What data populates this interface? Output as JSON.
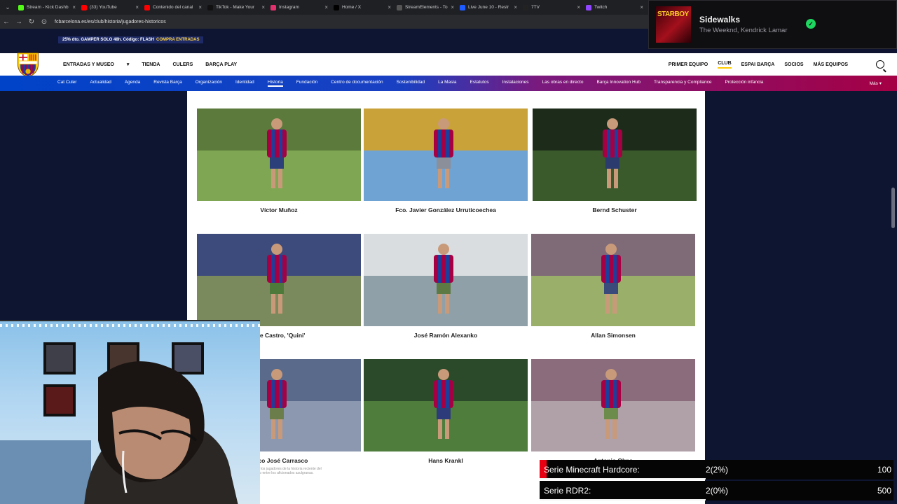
{
  "browser": {
    "tabs": [
      {
        "label": "Stream - Kick Dashb",
        "color": "#53fc18"
      },
      {
        "label": "(33) YouTube",
        "color": "#ff0000"
      },
      {
        "label": "Contenido del canal",
        "color": "#ff0000"
      },
      {
        "label": "TikTok - Make Your",
        "color": "#111111"
      },
      {
        "label": "Instagram",
        "color": "#e1306c"
      },
      {
        "label": "Home / X",
        "color": "#000000"
      },
      {
        "label": "StreamElements - To",
        "color": "#555555"
      },
      {
        "label": "Live June 10 - Restr",
        "color": "#1e5bff"
      },
      {
        "label": "7TV",
        "color": "#222222"
      },
      {
        "label": "Twitch",
        "color": "#9146ff"
      }
    ],
    "url": "fcbarcelona.es/es/club/historia/jugadores-historicos"
  },
  "now_playing": {
    "album_text": "STARBOY",
    "title": "Sidewalks",
    "artist": "The Weeknd, Kendrick Lamar"
  },
  "promo": {
    "text": "25% dto. GAMPER SOLO 48h. Código: FLASH",
    "cta": "COMPRA ENTRADAS"
  },
  "main_nav": {
    "left": [
      "ENTRADAS Y MUSEO",
      "TIENDA",
      "CULERS",
      "BARÇA PLAY"
    ],
    "right": [
      "PRIMER EQUIPO",
      "CLUB",
      "ESPAI BARÇA",
      "SOCIOS",
      "MÁS EQUIPOS"
    ],
    "active": "CLUB"
  },
  "sub_nav": {
    "items": [
      "Cat Culer",
      "Actualidad",
      "Agenda",
      "Revista Barça",
      "Organización",
      "Identidad",
      "Historia",
      "Fundación",
      "Centro de documentación",
      "Sostenibilidad",
      "La Masia",
      "Estatutos",
      "Instalaciones",
      "Las obras en directo",
      "Barça Innovation Hub",
      "Transparencia y Compliance",
      "Protección infancia"
    ],
    "active": "Historia",
    "more": "Más"
  },
  "players": [
    {
      "name": "Víctor Muñoz"
    },
    {
      "name": "Fco. Javier González Urruticoechea"
    },
    {
      "name": "Bernd Schuster"
    },
    {
      "name": "que Castro, 'Quini'"
    },
    {
      "name": "José Ramón Alexanko"
    },
    {
      "name": "Allan Simonsen"
    },
    {
      "name": "cisco José Carrasco",
      "desc": "959) es uno de los jugadores de la historia reciente del\nhan dejado entre los aficionados azulgranas."
    },
    {
      "name": "Hans Krankl"
    },
    {
      "name": "Antonio Olmo"
    }
  ],
  "goals": [
    {
      "label": "Serie Minecraft Hardcore:",
      "count": "2(2%)",
      "target": "100",
      "progress": 0.02
    },
    {
      "label": "Serie RDR2:",
      "count": "2(0%)",
      "target": "500",
      "progress": 0.0
    }
  ]
}
